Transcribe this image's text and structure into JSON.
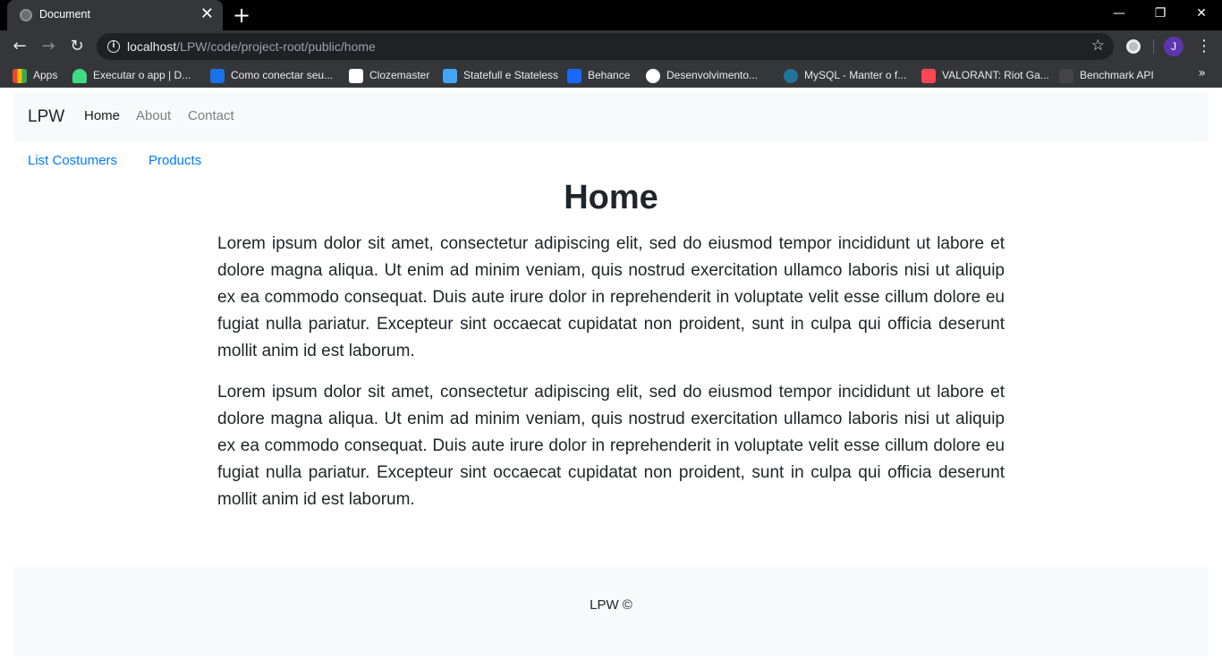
{
  "browser": {
    "tab_title": "Document",
    "url_host": "localhost",
    "url_path": "/LPW/code/project-root/public/home",
    "profile_initial": "J",
    "bookmarks": [
      {
        "label": "Apps",
        "color": "#ea4335"
      },
      {
        "label": "Executar o app | D...",
        "color": "#3ddc84"
      },
      {
        "label": "Como conectar seu...",
        "color": "#1a73e8"
      },
      {
        "label": "Clozemaster",
        "color": "#ffffff"
      },
      {
        "label": "Statefull e Stateless",
        "color": "#42a5f5"
      },
      {
        "label": "Behance",
        "color": "#1769ff"
      },
      {
        "label": "Desenvolvimento...",
        "color": "#ffffff"
      },
      {
        "label": "MySQL - Manter o f...",
        "color": "#21759b"
      },
      {
        "label": "VALORANT: Riot Ga...",
        "color": "#ff4655"
      },
      {
        "label": "Benchmark API",
        "color": "#222222"
      }
    ]
  },
  "navbar": {
    "brand": "LPW",
    "links": [
      "Home",
      "About",
      "Contact"
    ]
  },
  "subnav": {
    "links": [
      "List Costumers",
      "Products"
    ]
  },
  "main": {
    "heading": "Home",
    "paragraphs": [
      "Lorem ipsum dolor sit amet, consectetur adipiscing elit, sed do eiusmod tempor incididunt ut labore et dolore magna aliqua. Ut enim ad minim veniam, quis nostrud exercitation ullamco laboris nisi ut aliquip ex ea commodo consequat. Duis aute irure dolor in reprehenderit in voluptate velit esse cillum dolore eu fugiat nulla pariatur. Excepteur sint occaecat cupidatat non proident, sunt in culpa qui officia deserunt mollit anim id est laborum.",
      "Lorem ipsum dolor sit amet, consectetur adipiscing elit, sed do eiusmod tempor incididunt ut labore et dolore magna aliqua. Ut enim ad minim veniam, quis nostrud exercitation ullamco laboris nisi ut aliquip ex ea commodo consequat. Duis aute irure dolor in reprehenderit in voluptate velit esse cillum dolore eu fugiat nulla pariatur. Excepteur sint occaecat cupidatat non proident, sunt in culpa qui officia deserunt mollit anim id est laborum."
    ]
  },
  "footer": {
    "text": "LPW ©"
  }
}
